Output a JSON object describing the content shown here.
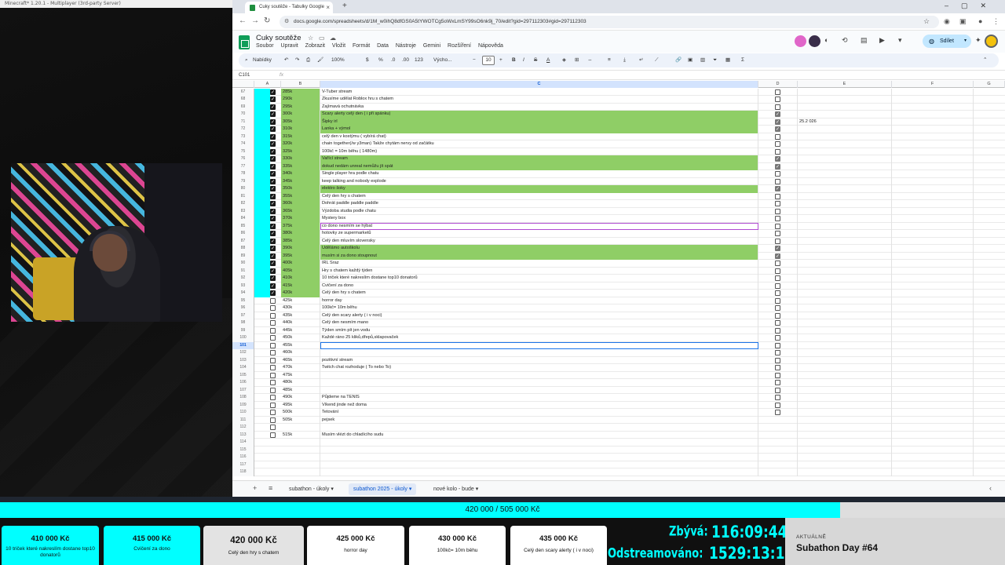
{
  "minecraft": {
    "window_title": "Minecraft* 1.20.1 - Multiplayer (3rd-party Server)"
  },
  "browser": {
    "tab_title": "Cuky soutěže - Tabulky Google",
    "url": "docs.google.com/spreadsheets/d/1M_w0ihQ8dfGS0A5tYWOTCg5oWxLmSY99sO6nk9j_70/edit?gid=297112303#gid=297112303"
  },
  "sheets": {
    "doc_title": "Cuky soutěže",
    "menu": [
      "Soubor",
      "Upravit",
      "Zobrazit",
      "Vložit",
      "Formát",
      "Data",
      "Nástroje",
      "Gemini",
      "Rozšíření",
      "Nápověda"
    ],
    "share_label": "Sdílet",
    "toolbar": {
      "search": "Nabídky",
      "zoom": "100%",
      "currency": "$",
      "percent": "%",
      "dec1": ".0",
      "dec2": ".00",
      "numfmt": "123",
      "font": "Výcho...",
      "font_size": "10"
    },
    "name_box": "C101",
    "fx": "fx",
    "columns": [
      "A",
      "B",
      "C",
      "D",
      "E",
      "F",
      "G"
    ],
    "rows": [
      {
        "n": "67",
        "b": "285k",
        "c": "V-Tuber stream",
        "a": true,
        "d": false,
        "green": false
      },
      {
        "n": "68",
        "b": "290k",
        "c": "Zkusíme udělat Roblox hru s chatem",
        "a": true,
        "d": false,
        "green": false
      },
      {
        "n": "69",
        "b": "295k",
        "c": "Zajímavá ochutnávka",
        "a": true,
        "d": false,
        "green": false
      },
      {
        "n": "70",
        "b": "300k",
        "c": "Scary alerty celý den ( i při spánku)",
        "a": true,
        "d": true,
        "green": true
      },
      {
        "n": "71",
        "b": "305k",
        "c": "Šipky irl",
        "a": true,
        "d": true,
        "green": true,
        "e": "25.2 026"
      },
      {
        "n": "72",
        "b": "310k",
        "c": "Lanka + výmol",
        "a": true,
        "d": true,
        "green": true
      },
      {
        "n": "73",
        "b": "315k",
        "c": "celý den v kostýmu ( vybírá chat)",
        "a": true,
        "d": false,
        "green": false
      },
      {
        "n": "74",
        "b": "320k",
        "c": "chain together(/w y3man) Takže chytám nervy od začátku",
        "a": true,
        "d": false,
        "green": false
      },
      {
        "n": "75",
        "b": "325k",
        "c": "100kč = 10m běhu ( 1480m)",
        "a": true,
        "d": false,
        "green": false
      },
      {
        "n": "76",
        "b": "330k",
        "c": "Vařící stream",
        "a": true,
        "d": true,
        "green": true
      },
      {
        "n": "77",
        "b": "335k",
        "c": "dokud nedám unreal nemůžu jít spát",
        "a": true,
        "d": true,
        "green": true
      },
      {
        "n": "78",
        "b": "340k",
        "c": "Single player hra podle chatu",
        "a": true,
        "d": false,
        "green": false
      },
      {
        "n": "79",
        "b": "345k",
        "c": "keep talking and nobody explode",
        "a": true,
        "d": false,
        "green": false
      },
      {
        "n": "80",
        "b": "350k",
        "c": "elektro šoky",
        "a": true,
        "d": true,
        "green": true
      },
      {
        "n": "81",
        "b": "355k",
        "c": "Celý den hry s chatem",
        "a": true,
        "d": false,
        "green": false
      },
      {
        "n": "82",
        "b": "360k",
        "c": "Dohrát paddle paddle paddle",
        "a": true,
        "d": false,
        "green": false
      },
      {
        "n": "83",
        "b": "365k",
        "c": "Výzdoba studia podle chatu",
        "a": true,
        "d": false,
        "green": false
      },
      {
        "n": "84",
        "b": "370k",
        "c": "Mystery box",
        "a": true,
        "d": false,
        "green": false
      },
      {
        "n": "85",
        "b": "375k",
        "c": "co dono nesmím se hýbat",
        "a": true,
        "d": false,
        "green": false,
        "hl": true
      },
      {
        "n": "86",
        "b": "380k",
        "c": "hotovky ze supermarketů",
        "a": true,
        "d": false,
        "green": false
      },
      {
        "n": "87",
        "b": "385k",
        "c": "Celý den mluvím slovensky",
        "a": true,
        "d": false,
        "green": false
      },
      {
        "n": "88",
        "b": "390k",
        "c": "Udělámo autoškolu",
        "a": true,
        "d": true,
        "green": true
      },
      {
        "n": "89",
        "b": "395k",
        "c": "musím si za dono stoupnout",
        "a": true,
        "d": true,
        "green": true
      },
      {
        "n": "90",
        "b": "400k",
        "c": "IRL Sraz",
        "a": true,
        "d": false,
        "green": false
      },
      {
        "n": "91",
        "b": "405k",
        "c": "Hry s chatem každý týden",
        "a": true,
        "d": false,
        "green": false
      },
      {
        "n": "92",
        "b": "410k",
        "c": "10 triček které nakreslím dostane top10 donatorů",
        "a": true,
        "d": false,
        "green": false
      },
      {
        "n": "93",
        "b": "415k",
        "c": "Cvičení za dono",
        "a": true,
        "d": false,
        "green": false
      },
      {
        "n": "94",
        "b": "420k",
        "c": "Celý den hry s chatem",
        "a": true,
        "d": false,
        "green": false
      },
      {
        "n": "95",
        "b": "425k",
        "c": "horror day",
        "a": false,
        "d": false,
        "green": false
      },
      {
        "n": "96",
        "b": "430k",
        "c": "100kč= 10m běhu",
        "a": false,
        "d": false,
        "green": false
      },
      {
        "n": "97",
        "b": "435k",
        "c": "Celý den scary alerty ( i v noci)",
        "a": false,
        "d": false,
        "green": false
      },
      {
        "n": "98",
        "b": "440k",
        "c": "Celý den nesmím mano",
        "a": false,
        "d": false,
        "green": false
      },
      {
        "n": "99",
        "b": "445k",
        "c": "Týden smím pít jen vodu",
        "a": false,
        "d": false,
        "green": false
      },
      {
        "n": "100",
        "b": "450k",
        "c": "Každé ráno 25 kliků,dřepů,sklapovaček",
        "a": false,
        "d": false,
        "green": false
      },
      {
        "n": "101",
        "b": "455k",
        "c": "",
        "a": false,
        "d": false,
        "green": false,
        "sel": true
      },
      {
        "n": "102",
        "b": "460k",
        "c": "",
        "a": false,
        "d": false,
        "green": false
      },
      {
        "n": "103",
        "b": "465k",
        "c": "pozitivní stream",
        "a": false,
        "d": false,
        "green": false
      },
      {
        "n": "104",
        "b": "470k",
        "c": "Twitch chat rozhoduje ( To nebo To)",
        "a": false,
        "d": false,
        "green": false
      },
      {
        "n": "105",
        "b": "475k",
        "c": "",
        "a": false,
        "d": false,
        "green": false
      },
      {
        "n": "106",
        "b": "480k",
        "c": "",
        "a": false,
        "d": false,
        "green": false
      },
      {
        "n": "107",
        "b": "485k",
        "c": "",
        "a": false,
        "d": false,
        "green": false
      },
      {
        "n": "108",
        "b": "490k",
        "c": "Půjdeme na TENIS",
        "a": false,
        "d": false,
        "green": false
      },
      {
        "n": "109",
        "b": "495k",
        "c": "Víkend jinde než doma",
        "a": false,
        "d": false,
        "green": false
      },
      {
        "n": "110",
        "b": "500k",
        "c": "Tetování",
        "a": false,
        "d": false,
        "green": false
      },
      {
        "n": "111",
        "b": "505k",
        "c": "pejsek",
        "a": false,
        "d": null,
        "green": false
      },
      {
        "n": "112",
        "b": "",
        "c": "",
        "a": false,
        "d": null,
        "green": false
      },
      {
        "n": "113",
        "b": "515k",
        "c": "Musím vlézt do chladícího sudu",
        "a": false,
        "d": null,
        "green": false
      },
      {
        "n": "114",
        "b": "",
        "c": "",
        "a": null,
        "d": null,
        "green": false
      },
      {
        "n": "115",
        "b": "",
        "c": "",
        "a": null,
        "d": null,
        "green": false
      },
      {
        "n": "116",
        "b": "",
        "c": "",
        "a": null,
        "d": null,
        "green": false
      },
      {
        "n": "117",
        "b": "",
        "c": "",
        "a": null,
        "d": null,
        "green": false
      },
      {
        "n": "118",
        "b": "",
        "c": "",
        "a": null,
        "d": null,
        "green": false
      }
    ],
    "sheet_tabs": [
      "subathon - úkoly",
      "subathon 2025 - úkoly",
      "nové kolo - bude"
    ],
    "active_tab": 1
  },
  "overlay": {
    "progress_text": "420 000 / 505 000 Kč",
    "progress_fraction": 0.836,
    "cards": [
      {
        "amount": "410 000 Kč",
        "label": "10 triček které nakreslím dostane top10 donatorů",
        "state": "done"
      },
      {
        "amount": "415 000 Kč",
        "label": "Cvičení za dono",
        "state": "done"
      },
      {
        "amount": "420 000 Kč",
        "label": "Celý den hry s chatem",
        "state": "current"
      },
      {
        "amount": "425 000 Kč",
        "label": "horror day",
        "state": "next"
      },
      {
        "amount": "430 000 Kč",
        "label": "100kč= 10m běhu",
        "state": "next"
      },
      {
        "amount": "435 000 Kč",
        "label": "Celý den scary alerty ( i v noci)",
        "state": "next"
      }
    ],
    "remaining_label": "Zbývá:",
    "remaining_value": "116:09:44",
    "streamed_label": "Odstreamováno:",
    "streamed_value": "1529:13:14",
    "current_label": "AKTUÁLNĚ",
    "current_title": "Subathon Day #64",
    "accent": "#00ffff",
    "green": "#8fce66"
  }
}
